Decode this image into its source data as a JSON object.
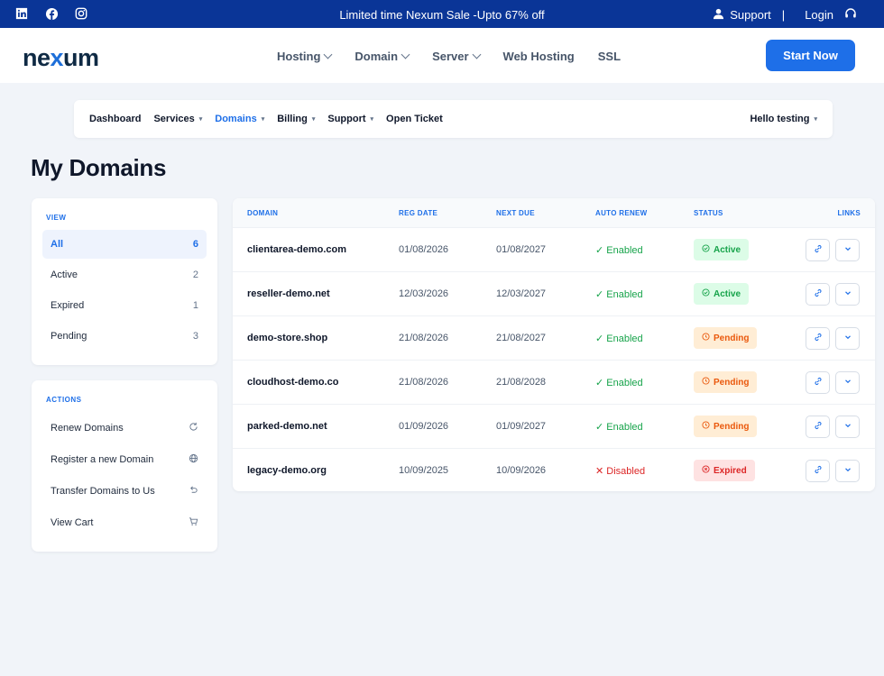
{
  "topbar": {
    "promo": "Limited time Nexum Sale -Upto 67% off",
    "support": "Support",
    "separator": "|",
    "login": "Login",
    "socials": [
      "linkedin-icon",
      "facebook-icon",
      "instagram-icon"
    ]
  },
  "header": {
    "logo_part1": "ne",
    "logo_part2": "x",
    "logo_part3": "um",
    "nav": [
      {
        "label": "Hosting",
        "dropdown": true
      },
      {
        "label": "Domain",
        "dropdown": true
      },
      {
        "label": "Server",
        "dropdown": true
      },
      {
        "label": "Web Hosting",
        "dropdown": false
      },
      {
        "label": "SSL",
        "dropdown": false
      }
    ],
    "cta": "Start Now"
  },
  "subnav": {
    "items": [
      {
        "label": "Dashboard"
      },
      {
        "label": "Services",
        "caret": "▾"
      },
      {
        "label": "Domains",
        "caret": "▾"
      },
      {
        "label": "Billing",
        "caret": "▾"
      },
      {
        "label": "Support",
        "caret": "▾"
      },
      {
        "label": "Open Ticket"
      }
    ],
    "user": "Hello testing",
    "user_caret": "▾"
  },
  "page_title": "My Domains",
  "view_filter": {
    "title": "VIEW",
    "items": [
      {
        "label": "All",
        "count": "6"
      },
      {
        "label": "Active",
        "count": "2"
      },
      {
        "label": "Expired",
        "count": "1"
      },
      {
        "label": "Pending",
        "count": "3"
      }
    ]
  },
  "actions": {
    "title": "ACTIONS",
    "items": [
      {
        "label": "Renew Domains",
        "icon": "refresh-icon"
      },
      {
        "label": "Register a new Domain",
        "icon": "globe-icon"
      },
      {
        "label": "Transfer Domains to Us",
        "icon": "undo-icon"
      },
      {
        "label": "View Cart",
        "icon": "cart-icon"
      }
    ]
  },
  "table": {
    "columns": [
      "DOMAIN",
      "REG DATE",
      "NEXT DUE",
      "AUTO RENEW",
      "STATUS",
      "LINKS"
    ],
    "rows": [
      {
        "domain": "clientarea-demo.com",
        "reg": "01/08/2026",
        "due": "01/08/2027",
        "renew": "✓ Enabled",
        "status": "Active"
      },
      {
        "domain": "reseller-demo.net",
        "reg": "12/03/2026",
        "due": "12/03/2027",
        "renew": "✓ Enabled",
        "status": "Active"
      },
      {
        "domain": "demo-store.shop",
        "reg": "21/08/2026",
        "due": "21/08/2027",
        "renew": "✓ Enabled",
        "status": "Pending"
      },
      {
        "domain": "cloudhost-demo.co",
        "reg": "21/08/2026",
        "due": "21/08/2028",
        "renew": "✓ Enabled",
        "status": "Pending"
      },
      {
        "domain": "parked-demo.net",
        "reg": "01/09/2026",
        "due": "01/09/2027",
        "renew": "✓ Enabled",
        "status": "Pending"
      },
      {
        "domain": "legacy-demo.org",
        "reg": "10/09/2025",
        "due": "10/09/2026",
        "renew": "✕ Disabled",
        "status": "Expired"
      }
    ]
  },
  "colors": {
    "primary": "#1e6fe8",
    "banner": "#0a3597",
    "success": "#16a34a",
    "warning": "#ea580c",
    "danger": "#dc2626"
  }
}
